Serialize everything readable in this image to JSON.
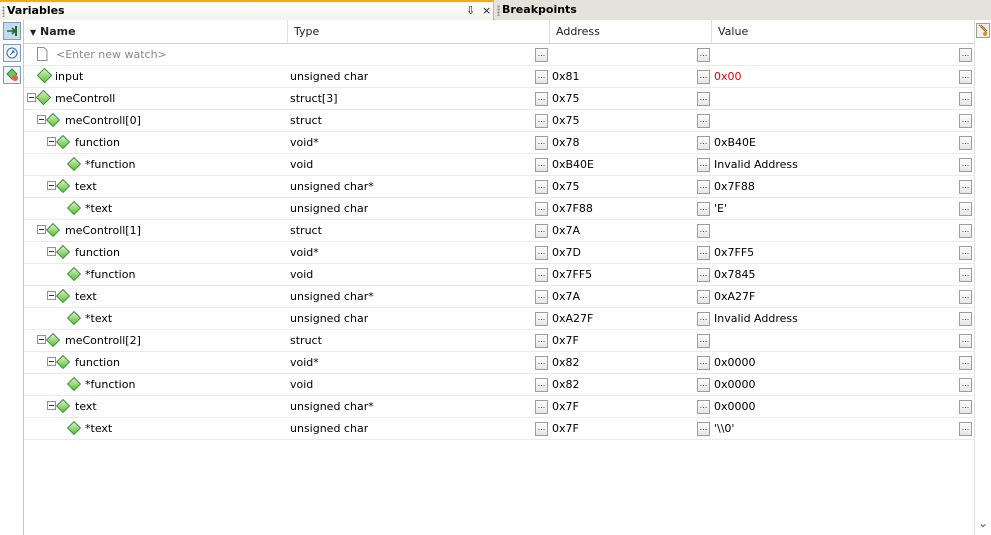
{
  "tabs": [
    {
      "label": "Variables",
      "active": true
    },
    {
      "label": "Breakpoints",
      "active": false
    }
  ],
  "tab_controls": {
    "menu": "⇩",
    "close": "×"
  },
  "columns": {
    "name": "Name",
    "type": "Type",
    "address": "Address",
    "value": "Value"
  },
  "sort_indicator": "▼",
  "watch_placeholder": "<Enter new watch>",
  "button_glyph": "...",
  "scroll_down": "⌄",
  "rows": [
    {
      "name": "input",
      "type": "unsigned char",
      "address": "0x81",
      "value": "0x00",
      "depth": 0,
      "expandable": false,
      "value_color": "#e00000"
    },
    {
      "name": "meControll",
      "type": "struct[3]",
      "address": "0x75",
      "value": "",
      "depth": 0,
      "expandable": true
    },
    {
      "name": "meControll[0]",
      "type": "struct",
      "address": "0x75",
      "value": "",
      "depth": 1,
      "expandable": true
    },
    {
      "name": "function",
      "type": "void*",
      "address": "0x78",
      "value": "0xB40E",
      "depth": 2,
      "expandable": true
    },
    {
      "name": "*function",
      "type": "void",
      "address": "0xB40E",
      "value": "Invalid Address",
      "depth": 3,
      "expandable": false
    },
    {
      "name": "text",
      "type": "unsigned char*",
      "address": "0x75",
      "value": "0x7F88",
      "depth": 2,
      "expandable": true
    },
    {
      "name": "*text",
      "type": "unsigned char",
      "address": "0x7F88",
      "value": "'E'",
      "depth": 3,
      "expandable": false
    },
    {
      "name": "meControll[1]",
      "type": "struct",
      "address": "0x7A",
      "value": "",
      "depth": 1,
      "expandable": true
    },
    {
      "name": "function",
      "type": "void*",
      "address": "0x7D",
      "value": "0x7FF5",
      "depth": 2,
      "expandable": true
    },
    {
      "name": "*function",
      "type": "void",
      "address": "0x7FF5",
      "value": "0x7845",
      "depth": 3,
      "expandable": false
    },
    {
      "name": "text",
      "type": "unsigned char*",
      "address": "0x7A",
      "value": "0xA27F",
      "depth": 2,
      "expandable": true
    },
    {
      "name": "*text",
      "type": "unsigned char",
      "address": "0xA27F",
      "value": "Invalid Address",
      "depth": 3,
      "expandable": false
    },
    {
      "name": "meControll[2]",
      "type": "struct",
      "address": "0x7F",
      "value": "",
      "depth": 1,
      "expandable": true
    },
    {
      "name": "function",
      "type": "void*",
      "address": "0x82",
      "value": "0x0000",
      "depth": 2,
      "expandable": true
    },
    {
      "name": "*function",
      "type": "void",
      "address": "0x82",
      "value": "0x0000",
      "depth": 3,
      "expandable": false
    },
    {
      "name": "text",
      "type": "unsigned char*",
      "address": "0x7F",
      "value": "0x0000",
      "depth": 2,
      "expandable": true
    },
    {
      "name": "*text",
      "type": "unsigned char",
      "address": "0x7F",
      "value": "'\\\\0'",
      "depth": 3,
      "expandable": false
    }
  ]
}
